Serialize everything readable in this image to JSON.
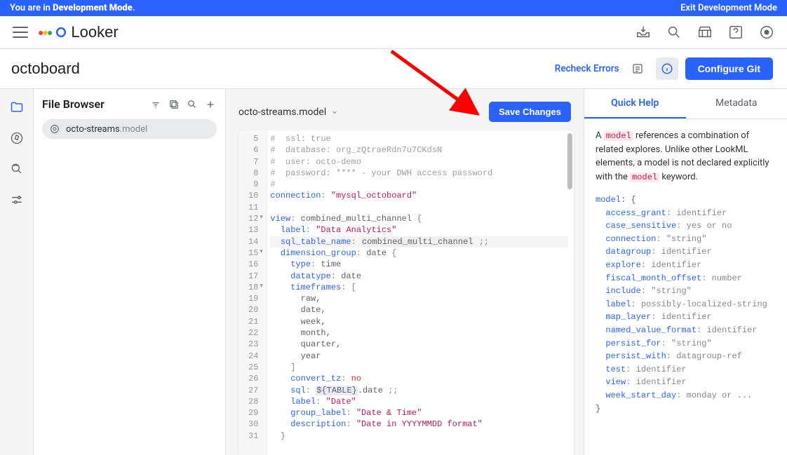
{
  "banner": {
    "mode_text": "You are in ",
    "mode_bold": "Development Mode",
    "exit": "Exit Development Mode"
  },
  "logo": {
    "text": "Looker"
  },
  "project": {
    "title": "octoboard"
  },
  "header": {
    "recheck": "Recheck Errors",
    "configure": "Configure Git"
  },
  "file_browser": {
    "title": "File Browser",
    "file_name": "octo-streams",
    "file_ext": ".model"
  },
  "editor": {
    "tab_label": "octo-streams.model",
    "save": "Save Changes",
    "gutter": [
      "5",
      "6",
      "7",
      "8",
      "9",
      "10",
      "11",
      "12",
      "13",
      "14",
      "15",
      "16",
      "17",
      "18",
      "19",
      "20",
      "21",
      "22",
      "23",
      "24",
      "25",
      "26",
      "27",
      "28",
      "29",
      "30",
      "31"
    ],
    "fold_lines": [
      12,
      15,
      18
    ],
    "lines": [
      {
        "t": "comment",
        "text": "#  ssl: true"
      },
      {
        "t": "comment",
        "text": "#  database: org_zQtraeRdn7u7CKdsN"
      },
      {
        "t": "comment",
        "text": "#  user: octo-demo"
      },
      {
        "t": "comment",
        "text": "#  password: **** - your DWH access password"
      },
      {
        "t": "comment",
        "text": "#"
      },
      {
        "t": "kv",
        "key": "connection",
        "str": "\"mysql_octoboard\""
      },
      {
        "t": "blank",
        "text": ""
      },
      {
        "t": "kv_open",
        "key": "view",
        "val": "combined_multi_channel",
        "open": "{"
      },
      {
        "t": "kv_indent",
        "indent": 1,
        "key": "label",
        "str": "\"Data Analytics\""
      },
      {
        "t": "kv_val_hl",
        "indent": 1,
        "key": "sql_table_name",
        "val": "combined_multi_channel",
        "trail": ";;"
      },
      {
        "t": "kv_open",
        "indent": 1,
        "key": "dimension_group",
        "val": "date",
        "open": "{"
      },
      {
        "t": "kv_plain",
        "indent": 2,
        "key": "type",
        "val": "time"
      },
      {
        "t": "kv_plain",
        "indent": 2,
        "key": "datatype",
        "val": "date"
      },
      {
        "t": "kv_bracket",
        "indent": 2,
        "key": "timeframes",
        "open": "["
      },
      {
        "t": "item",
        "indent": 3,
        "text": "raw,"
      },
      {
        "t": "item",
        "indent": 3,
        "text": "date,"
      },
      {
        "t": "item",
        "indent": 3,
        "text": "week,"
      },
      {
        "t": "item",
        "indent": 3,
        "text": "month,"
      },
      {
        "t": "item",
        "indent": 3,
        "text": "quarter,"
      },
      {
        "t": "item",
        "indent": 3,
        "text": "year"
      },
      {
        "t": "close",
        "indent": 2,
        "text": "]"
      },
      {
        "t": "kv_no",
        "indent": 2,
        "key": "convert_tz",
        "val": "no"
      },
      {
        "t": "kv_sql",
        "indent": 2,
        "key": "sql",
        "expr": "${TABLE}",
        "tail": ".date",
        "trail": ";;"
      },
      {
        "t": "kv_indent",
        "indent": 2,
        "key": "label",
        "str": "\"Date\""
      },
      {
        "t": "kv_indent",
        "indent": 2,
        "key": "group_label",
        "str": "\"Date & Time\""
      },
      {
        "t": "kv_indent",
        "indent": 2,
        "key": "description",
        "str": "\"Date in YYYYMMDD format\""
      },
      {
        "t": "close",
        "indent": 1,
        "text": "}"
      }
    ]
  },
  "help_panel": {
    "tabs": {
      "quick": "Quick Help",
      "metadata": "Metadata"
    },
    "intro_pre": "A ",
    "intro_code1": "model",
    "intro_mid": " references a combination of related explores. Unlike other LookML elements, a model is not declared explicitly with the ",
    "intro_code2": "model",
    "intro_post": " keyword.",
    "schema": [
      {
        "k": "model",
        "v": "{",
        "noColon": true
      },
      {
        "k": "access_grant",
        "v": "identifier",
        "i": 1
      },
      {
        "k": "case_sensitive",
        "v": "yes or no",
        "i": 1
      },
      {
        "k": "connection",
        "v": "\"string\"",
        "i": 1
      },
      {
        "k": "datagroup",
        "v": "identifier",
        "i": 1
      },
      {
        "k": "explore",
        "v": "identifier",
        "i": 1
      },
      {
        "k": "fiscal_month_offset",
        "v": "number",
        "i": 1
      },
      {
        "k": "include",
        "v": "\"string\"",
        "i": 1
      },
      {
        "k": "label",
        "v": "possibly-localized-string",
        "i": 1
      },
      {
        "k": "map_layer",
        "v": "identifier",
        "i": 1
      },
      {
        "k": "named_value_format",
        "v": "identifier",
        "i": 1
      },
      {
        "k": "persist_for",
        "v": "\"string\"",
        "i": 1
      },
      {
        "k": "persist_with",
        "v": "datagroup-ref",
        "i": 1
      },
      {
        "k": "test",
        "v": "identifier",
        "i": 1
      },
      {
        "k": "view",
        "v": "identifier",
        "i": 1
      },
      {
        "k": "week_start_day",
        "v": "monday or ...",
        "i": 1
      },
      {
        "k": "}",
        "v": "",
        "close": true
      }
    ]
  }
}
